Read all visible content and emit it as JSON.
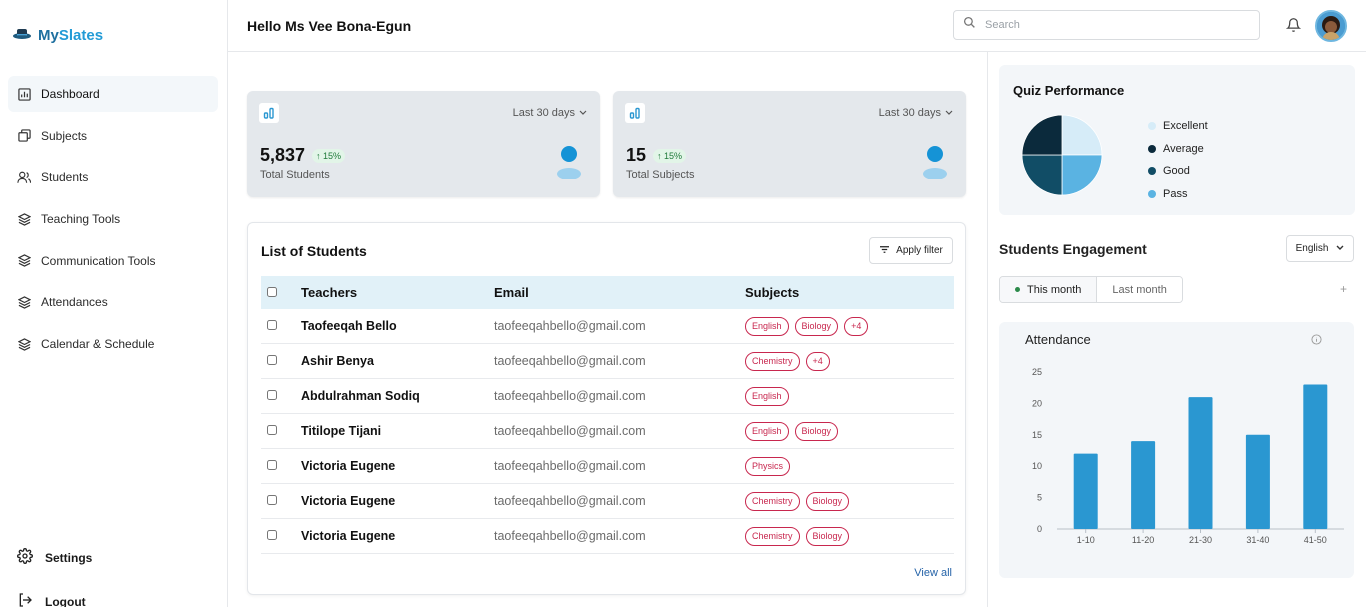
{
  "brand": {
    "name_part1": "My",
    "name_part2": "Slates"
  },
  "sidebar": {
    "items": [
      {
        "label": "Dashboard",
        "icon": "bar-chart-icon",
        "active": true
      },
      {
        "label": "Subjects",
        "icon": "copy-icon"
      },
      {
        "label": "Students",
        "icon": "users-icon"
      },
      {
        "label": "Teaching Tools",
        "icon": "layers-icon"
      },
      {
        "label": "Communication Tools",
        "icon": "layers-icon"
      },
      {
        "label": "Attendances",
        "icon": "layers-icon"
      },
      {
        "label": "Calendar & Schedule",
        "icon": "layers-icon"
      }
    ],
    "settings_label": "Settings",
    "logout_label": "Logout"
  },
  "header": {
    "greeting": "Hello Ms Vee Bona-Egun",
    "search_placeholder": "Search"
  },
  "stats": [
    {
      "range": "Last 30 days",
      "value": "5,837",
      "change": "↑ 15%",
      "label": "Total Students"
    },
    {
      "range": "Last 30 days",
      "value": "15",
      "change": "↑ 15%",
      "label": "Total Subjects"
    }
  ],
  "students_list": {
    "title": "List of Students",
    "filter_label": "Apply filter",
    "columns": [
      "Teachers",
      "Email",
      "Subjects"
    ],
    "rows": [
      {
        "name": "Taofeeqah Bello",
        "email": "taofeeqahbello@gmail.com",
        "subjects": [
          "English",
          "Biology",
          "+4"
        ]
      },
      {
        "name": "Ashir Benya",
        "email": "taofeeqahbello@gmail.com",
        "subjects": [
          "Chemistry",
          "+4"
        ]
      },
      {
        "name": "Abdulrahman Sodiq",
        "email": "taofeeqahbello@gmail.com",
        "subjects": [
          "English"
        ]
      },
      {
        "name": "Titilope Tijani",
        "email": "taofeeqahbello@gmail.com",
        "subjects": [
          "English",
          "Biology"
        ]
      },
      {
        "name": "Victoria Eugene",
        "email": "taofeeqahbello@gmail.com",
        "subjects": [
          "Physics"
        ]
      },
      {
        "name": "Victoria Eugene",
        "email": "taofeeqahbello@gmail.com",
        "subjects": [
          "Chemistry",
          "Biology"
        ]
      },
      {
        "name": "Victoria Eugene",
        "email": "taofeeqahbello@gmail.com",
        "subjects": [
          "Chemistry",
          "Biology"
        ]
      }
    ],
    "view_all_label": "View all"
  },
  "quiz": {
    "title": "Quiz Performance",
    "chart_data": {
      "type": "pie",
      "slices": [
        {
          "label": "Excellent",
          "value": 25,
          "color": "#d6ecf8"
        },
        {
          "label": "Average",
          "value": 25,
          "color": "#0b2a3c"
        },
        {
          "label": "Good",
          "value": 25,
          "color": "#114d66"
        },
        {
          "label": "Pass",
          "value": 25,
          "color": "#5ab3e2"
        }
      ]
    }
  },
  "engagement": {
    "title": "Students Engagement",
    "language": "English",
    "tabs": [
      "This month",
      "Last month"
    ],
    "add_label": "+"
  },
  "attendance": {
    "title": "Attendance",
    "chart_data": {
      "type": "bar",
      "title": "Attendance",
      "categories": [
        "1-10",
        "11-20",
        "21-30",
        "31-40",
        "41-50"
      ],
      "values": [
        12,
        14,
        21,
        15,
        23
      ],
      "yticks": [
        0,
        5,
        10,
        15,
        20,
        25
      ],
      "ylim": [
        0,
        25
      ],
      "bar_color": "#2a97d1"
    }
  }
}
